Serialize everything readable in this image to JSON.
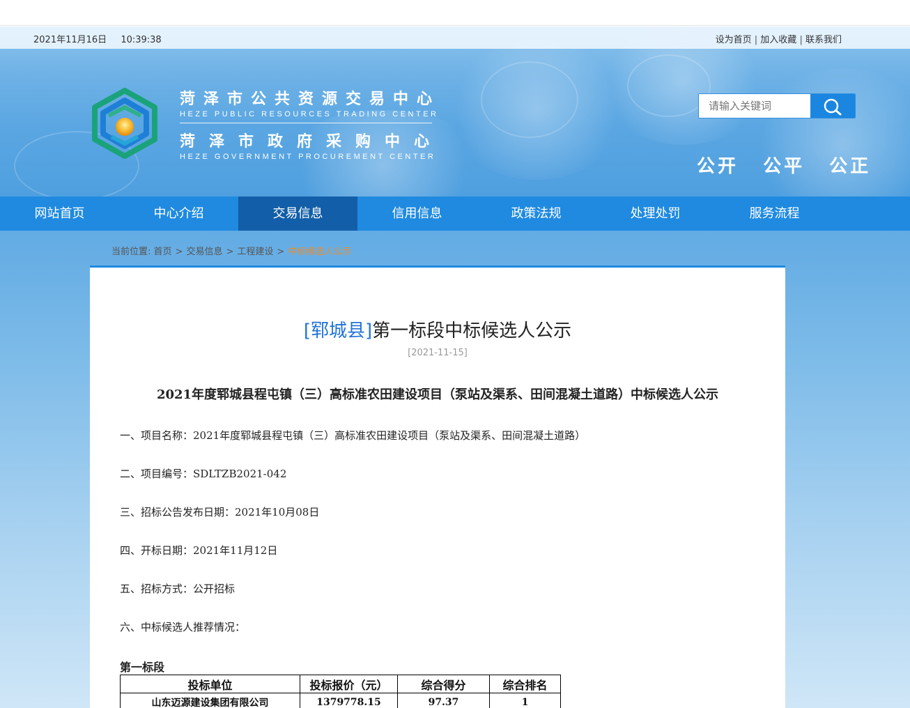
{
  "topbar": {
    "date": "2021年11月16日",
    "time": "10:39:38",
    "links": [
      "设为首页",
      "加入收藏",
      "联系我们"
    ],
    "separator": "|"
  },
  "header": {
    "org_cn_1": "菏泽市公共资源交易中心",
    "org_en_1": "HEZE PUBLIC RESOURCES TRADING CENTER",
    "org_cn_2": "菏泽市政府采购中心",
    "org_en_2": "HEZE GOVERNMENT PROCUREMENT CENTER",
    "search_placeholder": "请输入关键词",
    "search_icon": "search-icon",
    "slogan": [
      "公开",
      "公平",
      "公正"
    ]
  },
  "nav": {
    "items": [
      "网站首页",
      "中心介绍",
      "交易信息",
      "信用信息",
      "政策法规",
      "处理处罚",
      "服务流程"
    ],
    "active": "交易信息"
  },
  "breadcrumb": {
    "label": "当前位置:",
    "items": [
      "首页",
      "交易信息",
      "工程建设"
    ],
    "current": "中标候选人公示",
    "separator": ">"
  },
  "article": {
    "region": "[郓城县]",
    "title": "第一标段中标候选人公示",
    "date": "[2021-11-15]",
    "subtitle": "2021年度郓城县程屯镇（三）高标准农田建设项目（泵站及渠系、田间混凝土道路）中标候选人公示",
    "lines": [
      "一、项目名称：2021年度郓城县程屯镇（三）高标准农田建设项目（泵站及渠系、田间混凝土道路）",
      "二、项目编号：SDLTZB2021-042",
      "三、招标公告发布日期：2021年10月08日",
      "四、开标日期：2021年11月12日",
      "五、招标方式：公开招标",
      "六、中标候选人推荐情况："
    ],
    "section": "第一标段",
    "table": {
      "headers": [
        "投标单位",
        "投标报价（元）",
        "综合得分",
        "综合排名"
      ],
      "rows": [
        [
          "山东迈源建设集团有限公司",
          "1379778.15",
          "97.37",
          "1"
        ]
      ]
    }
  },
  "colors": {
    "nav_bg": "#1f8ae0",
    "nav_active": "#125ea8",
    "region_blue": "#2173d8",
    "breadcrumb_current": "#f08a24"
  }
}
